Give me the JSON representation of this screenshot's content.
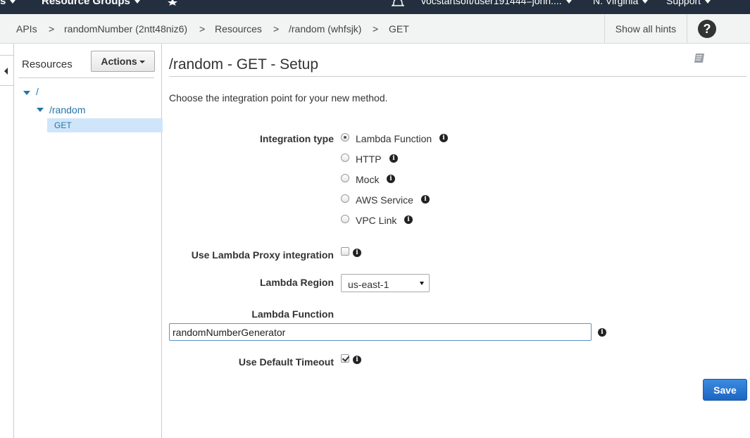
{
  "topnav": {
    "services_fragment": "s",
    "resource_groups": "Resource Groups",
    "pin_icon": "pin-icon",
    "bell_icon": "bell-icon",
    "account": "vocstartsoft/user191444=john....",
    "region": "N. Virginia",
    "support": "Support"
  },
  "breadcrumb": {
    "items": [
      "APIs",
      "randomNumber (2ntt48niz6)",
      "Resources",
      "/random (whfsjk)",
      "GET"
    ],
    "separator": ">",
    "show_hints": "Show all hints",
    "help_glyph": "?"
  },
  "sidebar": {
    "title": "Resources",
    "actions_label": "Actions",
    "tree": {
      "root": "/",
      "child": "/random",
      "method": "GET"
    }
  },
  "main": {
    "title": "/random - GET - Setup",
    "intro": "Choose the integration point for your new method.",
    "integration_type_label": "Integration type",
    "integration_options": [
      "Lambda Function",
      "HTTP",
      "Mock",
      "AWS Service",
      "VPC Link"
    ],
    "integration_selected": "Lambda Function",
    "proxy_label": "Use Lambda Proxy integration",
    "proxy_checked": false,
    "region_label": "Lambda Region",
    "region_value": "us-east-1",
    "function_label": "Lambda Function",
    "function_value": "randomNumberGenerator",
    "timeout_label": "Use Default Timeout",
    "timeout_checked": true,
    "save_label": "Save",
    "info_glyph": "i"
  },
  "colors": {
    "nav_bg": "#232f3e",
    "link": "#2574a9",
    "selected_row": "#cfe6fa",
    "save_button": "#1c66c3"
  }
}
